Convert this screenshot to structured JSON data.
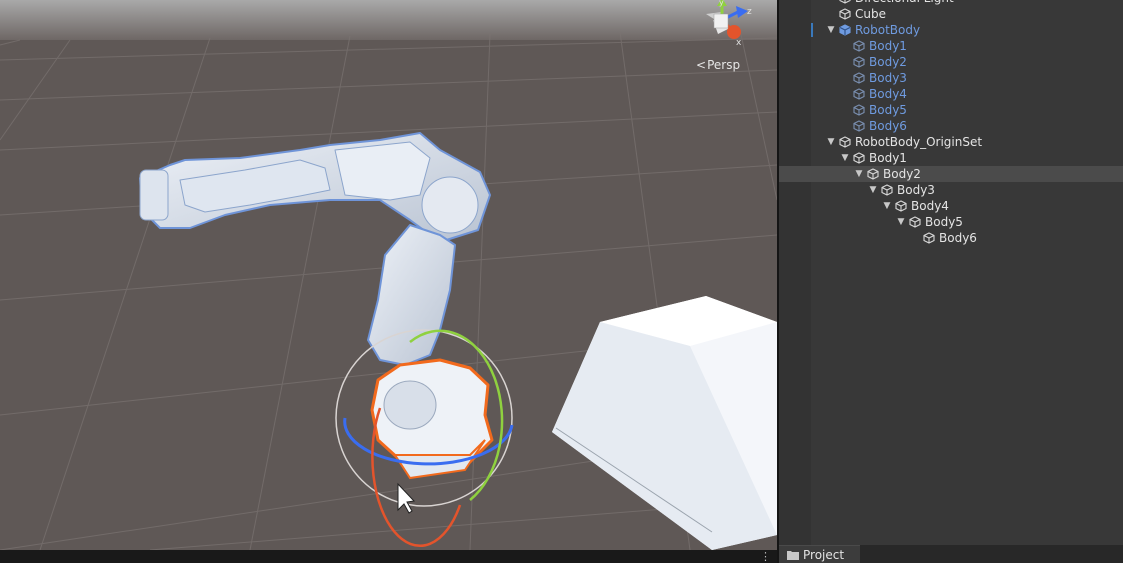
{
  "scene": {
    "view_mode_label": "Persp",
    "gizmo_axes": {
      "y": "y",
      "z": "z",
      "x": "x"
    },
    "colors": {
      "rotate_x": "#e3542c",
      "rotate_y": "#8fd13f",
      "rotate_z": "#3a6df0",
      "selection": "#f26a1d"
    }
  },
  "hierarchy": {
    "items": [
      {
        "label": "Directional Light",
        "depth": 0,
        "arrow": "",
        "style": "normal"
      },
      {
        "label": "Cube",
        "depth": 0,
        "arrow": "",
        "style": "normal"
      },
      {
        "label": "RobotBody",
        "depth": 0,
        "arrow": "▼",
        "style": "prefab"
      },
      {
        "label": "Body1",
        "depth": 1,
        "arrow": "",
        "style": "blue"
      },
      {
        "label": "Body2",
        "depth": 1,
        "arrow": "",
        "style": "blue"
      },
      {
        "label": "Body3",
        "depth": 1,
        "arrow": "",
        "style": "blue"
      },
      {
        "label": "Body4",
        "depth": 1,
        "arrow": "",
        "style": "blue"
      },
      {
        "label": "Body5",
        "depth": 1,
        "arrow": "",
        "style": "blue"
      },
      {
        "label": "Body6",
        "depth": 1,
        "arrow": "",
        "style": "blue"
      },
      {
        "label": "RobotBody_OriginSet",
        "depth": 0,
        "arrow": "▼",
        "style": "normal"
      },
      {
        "label": "Body1",
        "depth": 1,
        "arrow": "▼",
        "style": "normal"
      },
      {
        "label": "Body2",
        "depth": 2,
        "arrow": "▼",
        "style": "selected"
      },
      {
        "label": "Body3",
        "depth": 3,
        "arrow": "▼",
        "style": "normal"
      },
      {
        "label": "Body4",
        "depth": 4,
        "arrow": "▼",
        "style": "normal"
      },
      {
        "label": "Body5",
        "depth": 5,
        "arrow": "▼",
        "style": "normal"
      },
      {
        "label": "Body6",
        "depth": 6,
        "arrow": "",
        "style": "normal"
      }
    ]
  },
  "project": {
    "tab_label": "Project"
  }
}
